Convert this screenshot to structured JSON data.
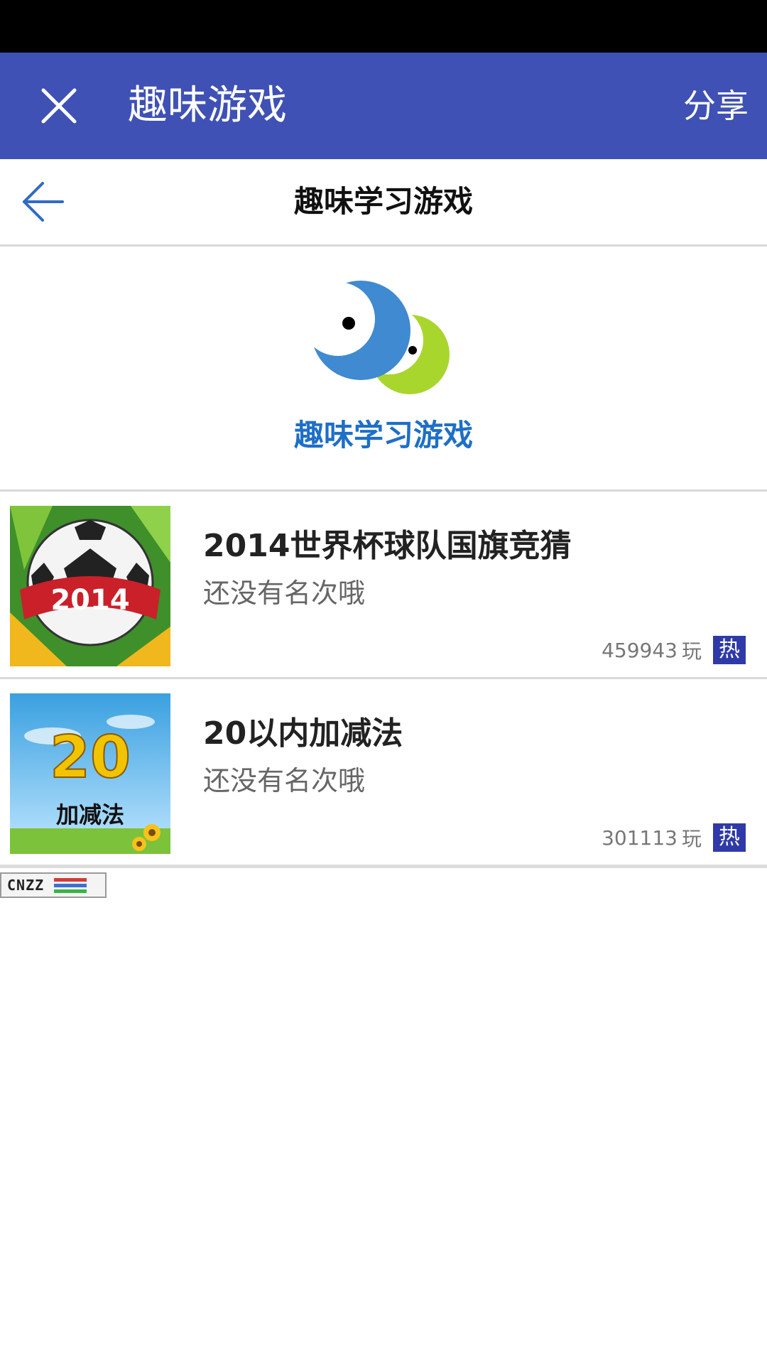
{
  "app_bar": {
    "title": "趣味游戏",
    "share_label": "分享",
    "close_icon": "close-icon",
    "background": "#3f51b5"
  },
  "sub_header": {
    "title": "趣味学习游戏",
    "back_icon": "arrow-left-icon"
  },
  "banner": {
    "title": "趣味学习游戏",
    "logo_icon": "moons-logo",
    "title_color": "#1e6fc7"
  },
  "games": [
    {
      "name": "2014世界杯球队国旗竞猜",
      "rank_text": "还没有名次哦",
      "play_count": "459943",
      "play_unit": "玩",
      "badge": "热",
      "thumb_text": "2014",
      "thumb_icon": "soccer-ball-thumbnail"
    },
    {
      "name": "20以内加减法",
      "rank_text": "还没有名次哦",
      "play_count": "301113",
      "play_unit": "玩",
      "badge": "热",
      "thumb_number": "20",
      "thumb_caption": "加减法",
      "thumb_icon": "sunflower-meadow-thumbnail"
    }
  ],
  "footer": {
    "cnzz_label": "CNZZ"
  },
  "colors": {
    "accent": "#3f51b5",
    "badge": "#2f3aa8",
    "status_bar": "#000000"
  }
}
